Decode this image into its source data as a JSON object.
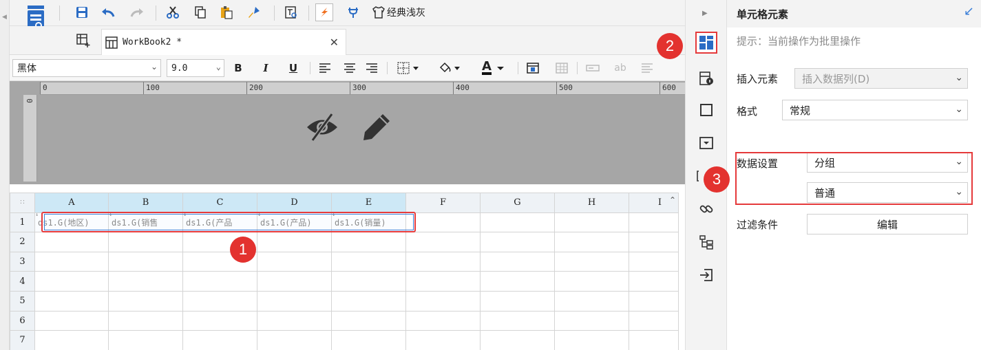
{
  "toolbar": {
    "theme_label": "经典浅灰"
  },
  "tab": {
    "title": "WorkBook2 *"
  },
  "format": {
    "font_family": "黑体",
    "font_size": "9.0",
    "bold": "B",
    "italic": "I",
    "underline": "U",
    "font_color_letter": "A",
    "ab_label": "ab"
  },
  "ruler": {
    "labels": [
      "0",
      "100",
      "200",
      "300",
      "400",
      "500",
      "600"
    ]
  },
  "grid": {
    "corner": "∷",
    "columns": [
      "A",
      "B",
      "C",
      "D",
      "E",
      "F",
      "G",
      "H",
      "I"
    ],
    "rows": [
      "1",
      "2",
      "3",
      "4",
      "5",
      "6",
      "7"
    ],
    "row1": [
      "ds1.G(地区)",
      "ds1.G(销售",
      "ds1.G(产品",
      "ds1.G(产品)",
      "ds1.G(销量)"
    ]
  },
  "panel": {
    "title": "单元格元素",
    "hint": "提示：当前操作为批里操作",
    "insert_label": "插入元素",
    "insert_value": "插入数据列(D)",
    "format_label": "格式",
    "format_value": "常规",
    "data_label": "数据设置",
    "data_value": "分组",
    "data_mode": "普通",
    "filter_label": "过滤条件",
    "filter_button": "编辑"
  },
  "callouts": [
    "1",
    "2",
    "3"
  ],
  "colors": {
    "accent_red": "#e3322f",
    "selection_blue": "#3b7fd8",
    "icon_blue": "#2b6cc4",
    "header_blue": "#cde8f6"
  }
}
